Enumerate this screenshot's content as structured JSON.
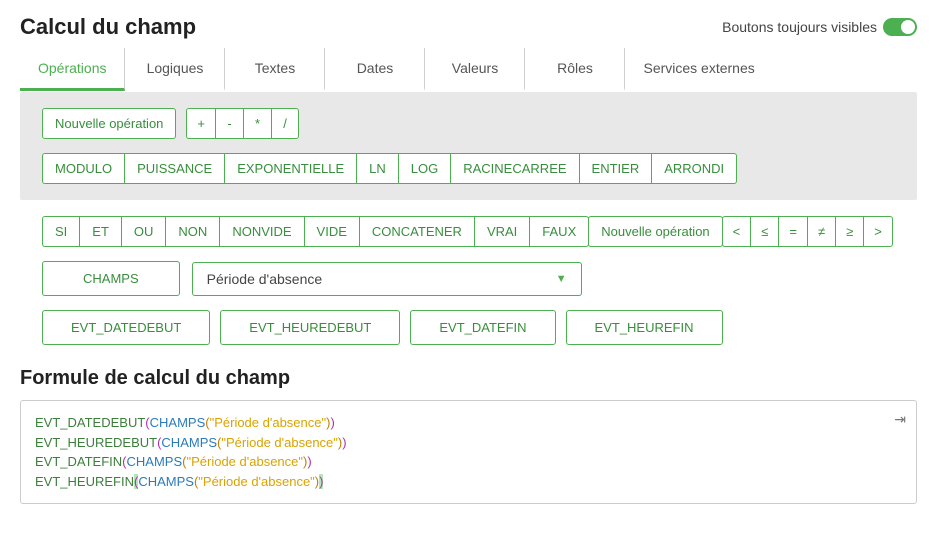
{
  "header": {
    "title": "Calcul du champ",
    "toggle_label": "Boutons toujours visibles",
    "toggle_on": true
  },
  "tabs": [
    {
      "label": "Opérations",
      "active": true
    },
    {
      "label": "Logiques"
    },
    {
      "label": "Textes"
    },
    {
      "label": "Dates"
    },
    {
      "label": "Valeurs"
    },
    {
      "label": "Rôles"
    },
    {
      "label": "Services externes"
    }
  ],
  "ops_panel": {
    "new_op": "Nouvelle opération",
    "arith": [
      "+",
      "-",
      "*",
      "/"
    ],
    "funcs": [
      "MODULO",
      "PUISSANCE",
      "EXPONENTIELLE",
      "LN",
      "LOG",
      "RACINECARREE",
      "ENTIER",
      "ARRONDI"
    ]
  },
  "cond_row": {
    "logic": [
      "SI",
      "ET",
      "OU",
      "NON",
      "NONVIDE",
      "VIDE",
      "CONCATENER",
      "VRAI",
      "FAUX"
    ],
    "new_op": "Nouvelle opération",
    "cmp": [
      "<",
      "≤",
      "=",
      "≠",
      "≥",
      ">"
    ]
  },
  "field_row": {
    "champs_label": "CHAMPS",
    "selected": "Période d'absence"
  },
  "evt_row": [
    "EVT_DATEDEBUT",
    "EVT_HEUREDEBUT",
    "EVT_DATEFIN",
    "EVT_HEUREFIN"
  ],
  "formula": {
    "title": "Formule de calcul du champ",
    "lines": [
      {
        "fn": "EVT_DATEDEBUT",
        "arg_fn": "CHAMPS",
        "str": "\"Période d'absence\""
      },
      {
        "fn": "EVT_HEUREDEBUT",
        "arg_fn": "CHAMPS",
        "str": "\"Période d'absence\""
      },
      {
        "fn": "EVT_DATEFIN",
        "arg_fn": "CHAMPS",
        "str": "\"Période d'absence\""
      },
      {
        "fn": "EVT_HEUREFIN",
        "arg_fn": "CHAMPS",
        "str": "\"Période d'absence\"",
        "caret": true
      }
    ]
  }
}
